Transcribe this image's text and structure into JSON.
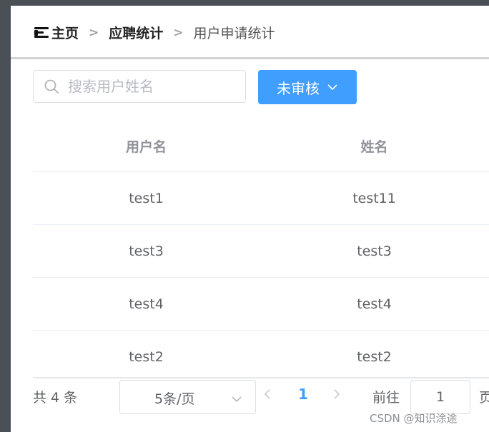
{
  "breadcrumb": {
    "home": "主页",
    "section": "应聘统计",
    "current": "用户申请统计",
    "separator": ">"
  },
  "search": {
    "placeholder": "搜索用户姓名",
    "value": ""
  },
  "status_filter": {
    "selected": "未审核"
  },
  "table": {
    "columns": [
      "用户名",
      "姓名"
    ],
    "rows": [
      [
        "test1",
        "test11"
      ],
      [
        "test3",
        "test3"
      ],
      [
        "test4",
        "test4"
      ],
      [
        "test2",
        "test2"
      ]
    ]
  },
  "pagination": {
    "total_label": "共 4 条",
    "page_size_label": "5条/页",
    "current_page": "1",
    "goto_prefix": "前往",
    "goto_value": "1",
    "goto_suffix": "页"
  },
  "watermark": "CSDN @知识涂途",
  "colors": {
    "primary": "#409eff",
    "sidebar": "#4b4f56",
    "border": "#dcdfe6"
  }
}
